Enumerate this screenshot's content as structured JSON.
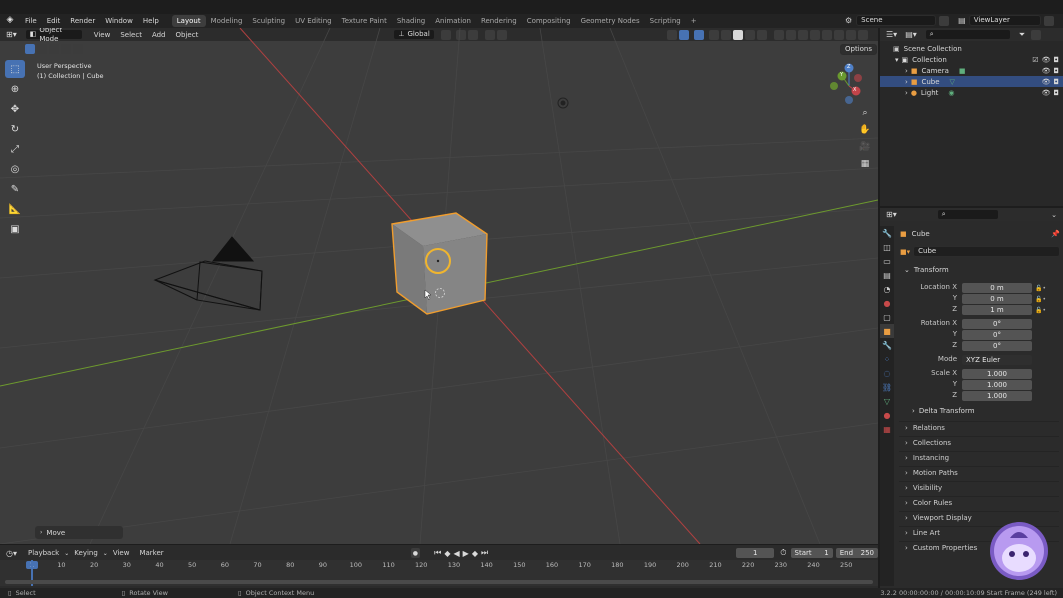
{
  "topbar": {
    "menus": [
      "File",
      "Edit",
      "Render",
      "Window",
      "Help"
    ],
    "workspaces": [
      "Layout",
      "Modeling",
      "Sculpting",
      "UV Editing",
      "Texture Paint",
      "Shading",
      "Animation",
      "Rendering",
      "Compositing",
      "Geometry Nodes",
      "Scripting"
    ],
    "active_workspace": "Layout",
    "add_workspace": "+",
    "scene": "Scene",
    "view_layer": "ViewLayer"
  },
  "viewport": {
    "mode": "Object Mode",
    "menus": [
      "View",
      "Select",
      "Add",
      "Object"
    ],
    "orientation": "Global",
    "options": "Options",
    "info_line1": "User Perspective",
    "info_line2": "(1) Collection | Cube",
    "last_op": "Move",
    "gizmo": {
      "x": "X",
      "y": "Y",
      "z": "Z"
    }
  },
  "outliner": {
    "rows": [
      {
        "label": "Scene Collection",
        "indent": 0,
        "icon": "scene-collection-icon"
      },
      {
        "label": "Collection",
        "indent": 1,
        "icon": "collection-icon"
      },
      {
        "label": "Camera",
        "indent": 2,
        "icon": "camera-icon"
      },
      {
        "label": "Cube",
        "indent": 2,
        "icon": "mesh-icon",
        "selected": true
      },
      {
        "label": "Light",
        "indent": 2,
        "icon": "light-icon"
      }
    ]
  },
  "properties": {
    "object_name": "Cube",
    "data_name": "Cube",
    "transform_title": "Transform",
    "location": {
      "label": "Location X",
      "x": "0 m",
      "y": "0 m",
      "z": "1 m"
    },
    "rotation": {
      "label": "Rotation X",
      "x": "0°",
      "y": "0°",
      "z": "0°"
    },
    "mode_label": "Mode",
    "mode_value": "XYZ Euler",
    "scale": {
      "label": "Scale X",
      "x": "1.000",
      "y": "1.000",
      "z": "1.000"
    },
    "axis_y": "Y",
    "axis_z": "Z",
    "delta_transform": "Delta Transform",
    "panels": [
      "Relations",
      "Collections",
      "Instancing",
      "Motion Paths",
      "Visibility",
      "Color Rules",
      "Viewport Display",
      "Line Art",
      "Custom Properties"
    ]
  },
  "timeline": {
    "menus": [
      "Playback",
      "Keying",
      "View",
      "Marker"
    ],
    "current_frame": "1",
    "start_label": "Start",
    "start": "1",
    "end_label": "End",
    "end": "250",
    "ticks": [
      "1",
      "10",
      "20",
      "30",
      "40",
      "50",
      "60",
      "70",
      "80",
      "90",
      "100",
      "110",
      "120",
      "130",
      "140",
      "150",
      "160",
      "170",
      "180",
      "190",
      "200",
      "210",
      "220",
      "230",
      "240",
      "250"
    ]
  },
  "statusbar": {
    "select": "Select",
    "rotate": "Rotate View",
    "context": "Object Context Menu",
    "info": "3.2.2  00:00:00:00 / 00:00:10:09  Start Frame (249 left)"
  },
  "colors": {
    "accent": "#4772b3",
    "selection_orange": "#f09d2e",
    "x_axis": "#c3444a",
    "y_axis": "#6a9a2e",
    "z_axis": "#4f80c8"
  }
}
